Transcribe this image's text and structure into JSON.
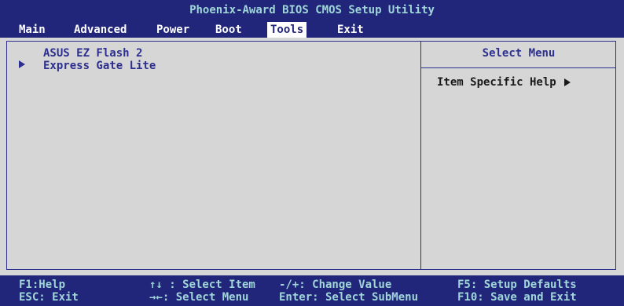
{
  "window": {
    "title": "Phoenix-Award BIOS CMOS Setup Utility"
  },
  "menu": {
    "items": [
      {
        "label": "Main"
      },
      {
        "label": "Advanced"
      },
      {
        "label": "Power"
      },
      {
        "label": "Boot"
      },
      {
        "label": "Tools"
      },
      {
        "label": "Exit"
      }
    ],
    "selected": "Tools"
  },
  "tools": {
    "items": [
      {
        "label": "ASUS EZ Flash 2"
      },
      {
        "label": "Express Gate Lite"
      }
    ]
  },
  "help": {
    "title": "Select Menu",
    "text": "Item Specific Help"
  },
  "footer": {
    "f1": "F1:Help",
    "esc": "ESC: Exit",
    "updown": "↑↓ : Select Item",
    "leftright": "→←: Select Menu",
    "change": "-/+: Change Value",
    "enter": "Enter: Select SubMenu",
    "f5": "F5: Setup Defaults",
    "f10": "F10: Save and Exit"
  },
  "colors": {
    "bar_bg": "#22267a",
    "title_text": "#9fd6d8",
    "panel_bg": "#d6d6d6",
    "panel_text": "#2d2f8f"
  },
  "icons": {
    "submenu": "right-triangle",
    "help": "right-triangle"
  }
}
